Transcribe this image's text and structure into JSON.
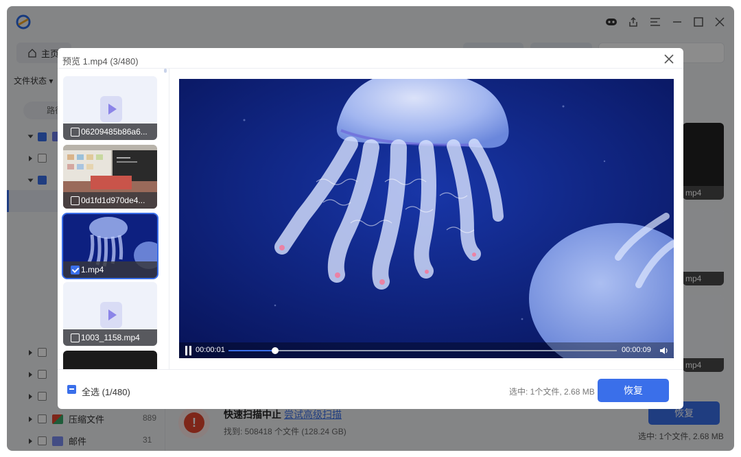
{
  "colors": {
    "accent": "#3a6fea",
    "danger": "#e6452f"
  },
  "background": {
    "home_tab": "主页",
    "filter_label": "文件状态",
    "path_pill": "路径",
    "tree": [
      {
        "label": "压缩文件",
        "count": "889"
      },
      {
        "label": "邮件",
        "count": "31"
      }
    ],
    "thumb_labels": [
      "mp4",
      "mp4",
      "mp4"
    ],
    "scan_title": "快速扫描中止",
    "scan_link": "尝试高级扫描",
    "scan_found": "找到: 508418 个文件 (128.24 GB)",
    "recover_label": "恢复",
    "selected_info": "选中: 1个文件, 2.68 MB"
  },
  "modal": {
    "title": "预览 1.mp4 (3/480)",
    "thumbnails": [
      {
        "name": "06209485b86a6...",
        "checked": false,
        "kind": "placeholder"
      },
      {
        "name": "0d1fd1d970de4...",
        "checked": false,
        "kind": "screen"
      },
      {
        "name": "1.mp4",
        "checked": true,
        "kind": "jellyfish"
      },
      {
        "name": "1003_1158.mp4",
        "checked": false,
        "kind": "placeholder"
      }
    ],
    "player": {
      "current_time": "00:00:01",
      "duration": "00:00:09",
      "progress": 0.12
    },
    "select_all": "全选 (1/480)",
    "selected_info": "选中: 1个文件, 2.68 MB",
    "recover_label": "恢复"
  }
}
